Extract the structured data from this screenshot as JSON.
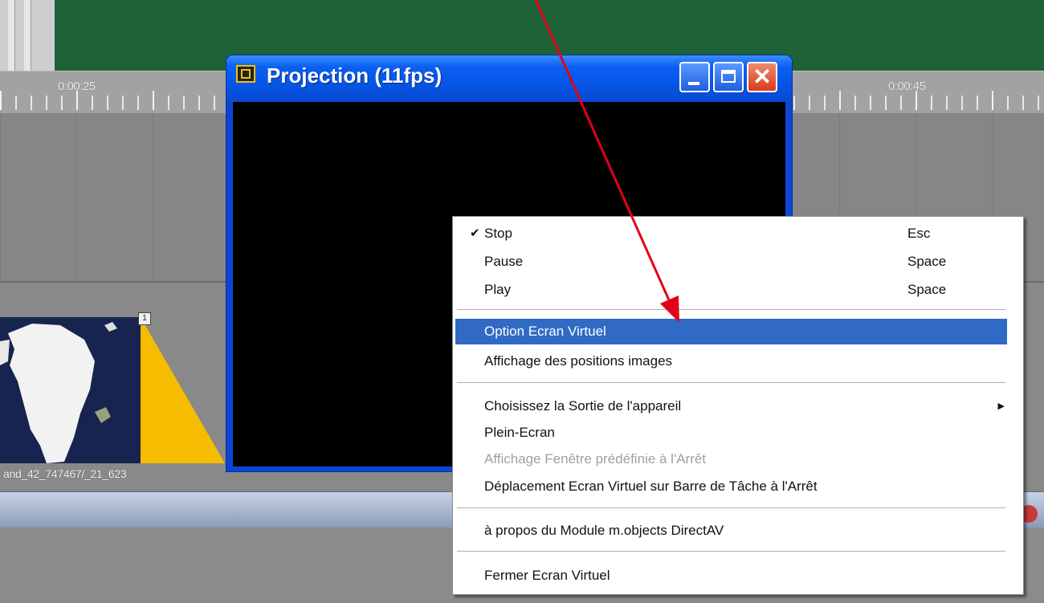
{
  "ruler": {
    "time_left": "0:00:25",
    "time_right": "0:00:45"
  },
  "clip": {
    "name": "and_42_747467/_21_623",
    "marker": "1"
  },
  "projection_window": {
    "title": "Projection (11fps)"
  },
  "context_menu": {
    "items": [
      {
        "label": "Stop",
        "shortcut": "Esc",
        "checked": true
      },
      {
        "label": "Pause",
        "shortcut": "Space"
      },
      {
        "label": "Play",
        "shortcut": "Space"
      },
      {
        "label": "Option Ecran Virtuel",
        "highlighted": true
      },
      {
        "label": "Affichage des positions images"
      },
      {
        "label": "Choisissez la Sortie de l'appareil",
        "submenu": true
      },
      {
        "label": "Plein-Ecran"
      },
      {
        "label": "Affichage Fenêtre prédéfinie à l'Arrêt",
        "disabled": true
      },
      {
        "label": "Déplacement Ecran Virtuel sur Barre de Tâche à l'Arrêt"
      },
      {
        "label": "à propos du Module m.objects DirectAV"
      },
      {
        "label": "Fermer Ecran Virtuel"
      }
    ]
  },
  "colors": {
    "accent": "#316ac5",
    "title_bar": "#0a5ff2",
    "annotation_arrow": "#e3001b",
    "green_area": "#1e6238",
    "transition": "#f5bc00"
  },
  "icons": {
    "window": "projection-app-icon",
    "minimize": "minimize-icon",
    "maximize": "maximize-icon",
    "close": "close-icon",
    "check": "checkmark-icon",
    "submenu": "submenu-arrow-icon"
  }
}
